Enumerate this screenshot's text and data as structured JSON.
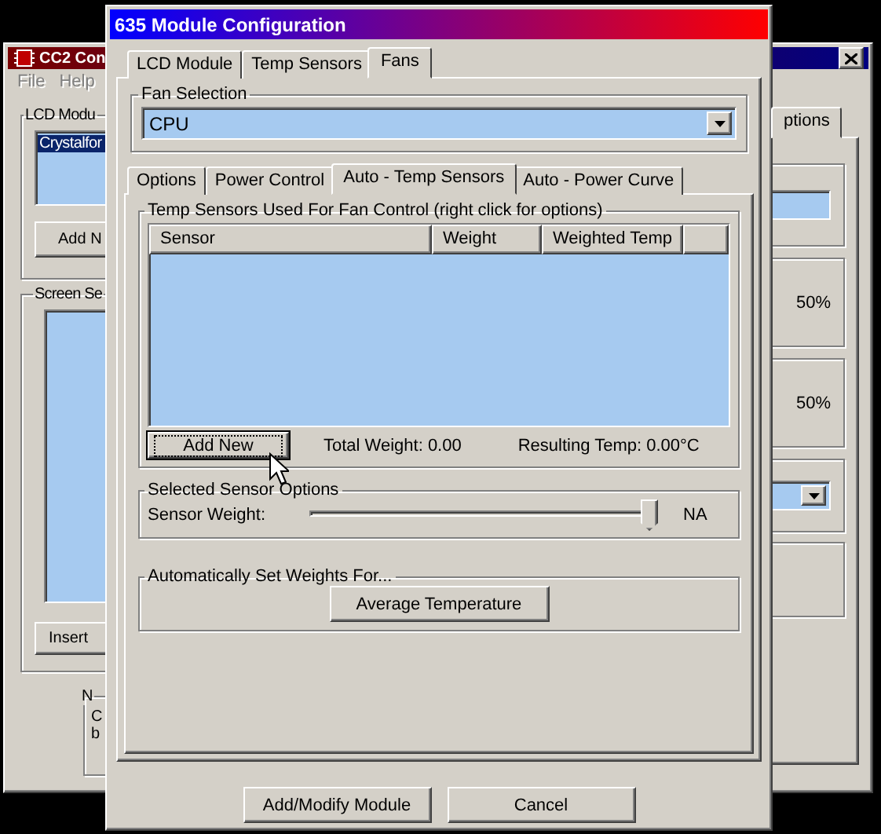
{
  "back_window": {
    "title": "CC2 Con",
    "menu": [
      "File",
      "Help"
    ],
    "lcd_group": "LCD Modu",
    "list_items": [
      {
        "label": "Crystalfor",
        "selected": true
      }
    ],
    "add_button": "Add N",
    "screen_group": "Screen Se",
    "insert_button": "Insert",
    "notes_group": "N",
    "notes_lines": [
      "C",
      "b"
    ],
    "tabs": [
      {
        "label": "ptions",
        "selected": true
      }
    ],
    "readings": [
      "50%",
      "50%"
    ]
  },
  "dialog": {
    "title": "635 Module Configuration",
    "tabs": [
      {
        "label": "LCD Module",
        "selected": false
      },
      {
        "label": "Temp Sensors",
        "selected": false
      },
      {
        "label": "Fans",
        "selected": true
      }
    ],
    "fan_selection": {
      "label": "Fan Selection",
      "value": "CPU"
    },
    "sub_tabs": [
      {
        "label": "Options",
        "selected": false
      },
      {
        "label": "Power Control",
        "selected": false
      },
      {
        "label": "Auto - Temp Sensors",
        "selected": true
      },
      {
        "label": "Auto - Power Curve",
        "selected": false
      }
    ],
    "sensors_group": {
      "label": "Temp Sensors Used For Fan Control (right click for options)",
      "columns": [
        "Sensor",
        "Weight",
        "Weighted Temp"
      ],
      "add_button": "Add New",
      "total_weight": "Total Weight: 0.00",
      "resulting_temp": "Resulting Temp: 0.00°C"
    },
    "sensor_options": {
      "label": "Selected Sensor Options",
      "weight_label": "Sensor Weight:",
      "level": 1,
      "reading": "NA"
    },
    "auto_weights": {
      "label": "Automatically Set Weights For...",
      "button": "Average Temperature"
    },
    "buttons": [
      "Add/Modify Module",
      "Cancel"
    ]
  }
}
